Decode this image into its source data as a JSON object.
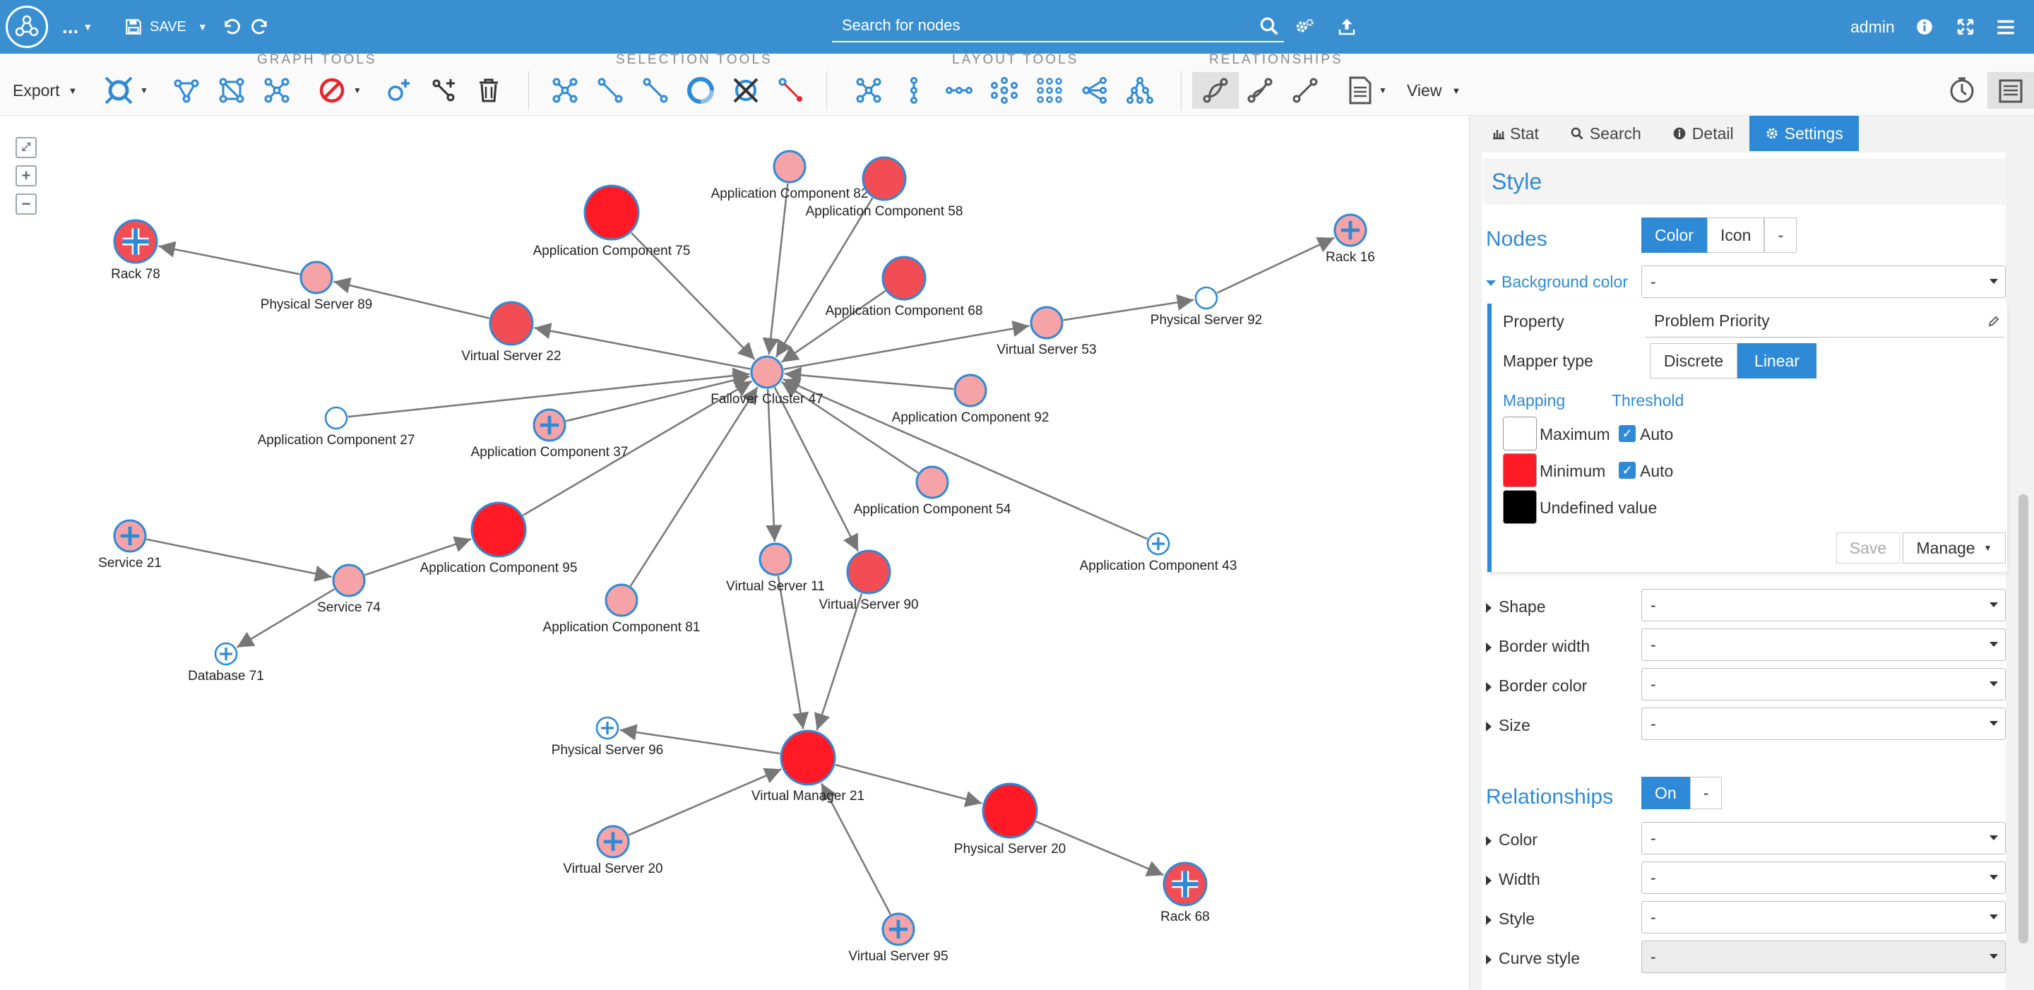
{
  "header": {
    "more_label": "...",
    "save_label": "SAVE",
    "search_placeholder": "Search for nodes",
    "user": "admin"
  },
  "toolbar": {
    "export_label": "Export",
    "view_label": "View",
    "groups": {
      "graph_tools": "GRAPH TOOLS",
      "selection_tools": "SELECTION TOOLS",
      "layout_tools": "LAYOUT TOOLS",
      "relationships": "RELATIONSHIPS"
    }
  },
  "graph": {
    "nodes": [
      {
        "id": "Rack 78",
        "fill": "#f24c55",
        "type": "rack"
      },
      {
        "id": "Physical Server 89",
        "fill": "#f5a3a6",
        "type": "plain"
      },
      {
        "id": "Virtual Server 22",
        "fill": "#f24c55",
        "type": "plain"
      },
      {
        "id": "Application Component 75",
        "fill": "#ff1a26",
        "type": "plain"
      },
      {
        "id": "Application Component 82",
        "fill": "#f5a3a6",
        "type": "plain"
      },
      {
        "id": "Application Component 58",
        "fill": "#f24c55",
        "type": "plain"
      },
      {
        "id": "Application Component 68",
        "fill": "#f24c55",
        "type": "plain"
      },
      {
        "id": "Virtual Server 53",
        "fill": "#f5a3a6",
        "type": "plain"
      },
      {
        "id": "Physical Server 92",
        "fill": "#ffffff",
        "type": "plain"
      },
      {
        "id": "Rack 16",
        "fill": "#f5a3a6",
        "type": "plus"
      },
      {
        "id": "Application Component 27",
        "fill": "#ffffff",
        "type": "plain"
      },
      {
        "id": "Application Component 37",
        "fill": "#f5a3a6",
        "type": "plus"
      },
      {
        "id": "Failover Cluster 47",
        "fill": "#f5a3a6",
        "type": "plain"
      },
      {
        "id": "Application Component 92",
        "fill": "#f5a3a6",
        "type": "plain"
      },
      {
        "id": "Application Component 54",
        "fill": "#f5a3a6",
        "type": "plain"
      },
      {
        "id": "Application Component 43",
        "fill": "#ffffff",
        "type": "plus"
      },
      {
        "id": "Service 21",
        "fill": "#f5a3a6",
        "type": "plus"
      },
      {
        "id": "Service 74",
        "fill": "#f5a3a6",
        "type": "plain"
      },
      {
        "id": "Database 71",
        "fill": "#ffffff",
        "type": "plus"
      },
      {
        "id": "Application Component 95",
        "fill": "#ff1a26",
        "type": "plain"
      },
      {
        "id": "Application Component 81",
        "fill": "#f5a3a6",
        "type": "plain"
      },
      {
        "id": "Virtual Server 11",
        "fill": "#f5a3a6",
        "type": "plain"
      },
      {
        "id": "Virtual Server 90",
        "fill": "#f24c55",
        "type": "plain"
      },
      {
        "id": "Physical Server 96",
        "fill": "#ffffff",
        "type": "plus"
      },
      {
        "id": "Virtual Manager 21",
        "fill": "#ff1a26",
        "type": "plain"
      },
      {
        "id": "Physical Server 20",
        "fill": "#ff1a26",
        "type": "plain"
      },
      {
        "id": "Rack 68",
        "fill": "#f24c55",
        "type": "rack"
      },
      {
        "id": "Virtual Server 20",
        "fill": "#f5a3a6",
        "type": "plus"
      },
      {
        "id": "Virtual Server 95",
        "fill": "#f5a3a6",
        "type": "plus"
      }
    ],
    "edges": [
      [
        "Physical Server 89",
        "Rack 78"
      ],
      [
        "Virtual Server 22",
        "Physical Server 89"
      ],
      [
        "Failover Cluster 47",
        "Virtual Server 22"
      ],
      [
        "Application Component 75",
        "Failover Cluster 47"
      ],
      [
        "Application Component 82",
        "Failover Cluster 47"
      ],
      [
        "Application Component 58",
        "Failover Cluster 47"
      ],
      [
        "Application Component 68",
        "Failover Cluster 47"
      ],
      [
        "Failover Cluster 47",
        "Virtual Server 53"
      ],
      [
        "Virtual Server 53",
        "Physical Server 92"
      ],
      [
        "Physical Server 92",
        "Rack 16"
      ],
      [
        "Application Component 27",
        "Failover Cluster 47"
      ],
      [
        "Application Component 37",
        "Failover Cluster 47"
      ],
      [
        "Application Component 92",
        "Failover Cluster 47"
      ],
      [
        "Application Component 54",
        "Failover Cluster 47"
      ],
      [
        "Application Component 43",
        "Failover Cluster 47"
      ],
      [
        "Application Component 95",
        "Failover Cluster 47"
      ],
      [
        "Application Component 81",
        "Failover Cluster 47"
      ],
      [
        "Failover Cluster 47",
        "Virtual Server 11"
      ],
      [
        "Failover Cluster 47",
        "Virtual Server 90"
      ],
      [
        "Service 21",
        "Service 74"
      ],
      [
        "Service 74",
        "Application Component 95"
      ],
      [
        "Service 74",
        "Database 71"
      ],
      [
        "Virtual Server 11",
        "Virtual Manager 21"
      ],
      [
        "Virtual Server 90",
        "Virtual Manager 21"
      ],
      [
        "Virtual Manager 21",
        "Physical Server 96"
      ],
      [
        "Virtual Server 20",
        "Virtual Manager 21"
      ],
      [
        "Virtual Server 95",
        "Virtual Manager 21"
      ],
      [
        "Virtual Manager 21",
        "Physical Server 20"
      ],
      [
        "Physical Server 20",
        "Rack 68"
      ]
    ]
  },
  "panel": {
    "tabs": [
      {
        "label": "Stat",
        "icon": "bar-chart-icon",
        "active": false
      },
      {
        "label": "Search",
        "icon": "search-icon",
        "active": false
      },
      {
        "label": "Detail",
        "icon": "info-icon",
        "active": false
      },
      {
        "label": "Settings",
        "icon": "gear-icon",
        "active": true
      }
    ],
    "style_title": "Style",
    "nodes": {
      "title": "Nodes",
      "mode_buttons": [
        "Color",
        "Icon",
        "-"
      ],
      "background_color_label": "Background color",
      "background_color_value": "-",
      "property_label": "Property",
      "property_value": "Problem Priority",
      "mapper_type_label": "Mapper type",
      "mapper_types": [
        "Discrete",
        "Linear"
      ],
      "mapping_tab": "Mapping",
      "threshold_tab": "Threshold",
      "maximum_label": "Maximum",
      "minimum_label": "Minimum",
      "undefined_label": "Undefined value",
      "auto_label": "Auto",
      "save_label": "Save",
      "manage_label": "Manage",
      "maximum_color": "#ffffff",
      "minimum_color": "#ff1a26",
      "undefined_color": "#000000"
    },
    "node_props": [
      {
        "label": "Shape",
        "value": "-"
      },
      {
        "label": "Border width",
        "value": "-"
      },
      {
        "label": "Border color",
        "value": "-"
      },
      {
        "label": "Size",
        "value": "-"
      }
    ],
    "relationships": {
      "title": "Relationships",
      "toggle": [
        "On",
        "-"
      ],
      "props": [
        {
          "label": "Color",
          "value": "-"
        },
        {
          "label": "Width",
          "value": "-"
        },
        {
          "label": "Style",
          "value": "-"
        },
        {
          "label": "Curve style",
          "value": "-"
        }
      ]
    }
  }
}
